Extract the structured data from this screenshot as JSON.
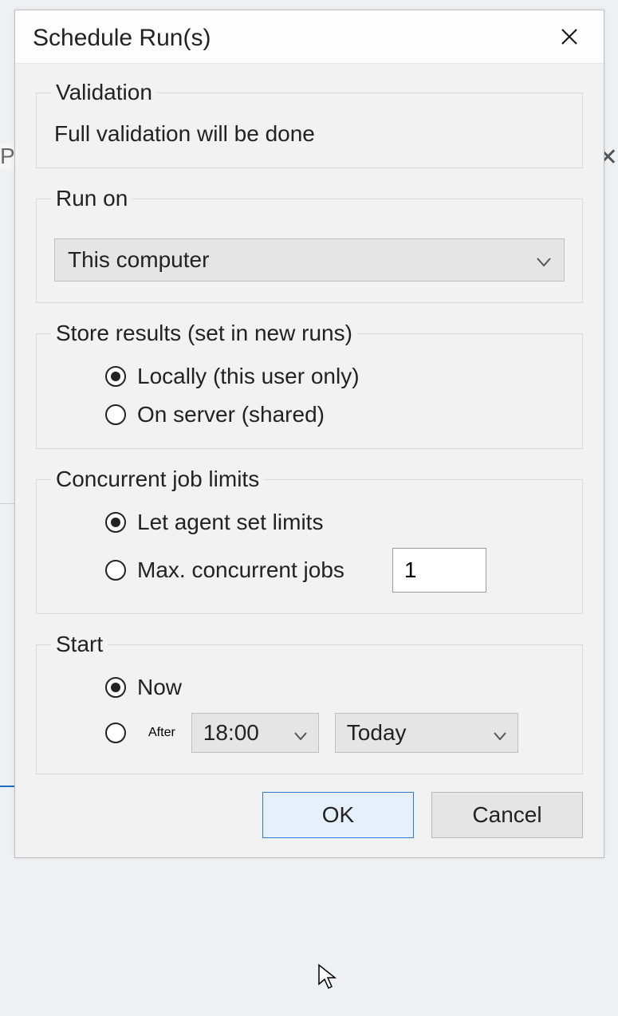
{
  "background": {
    "partial_tab_letter": "P"
  },
  "dialog": {
    "title": "Schedule Run(s)",
    "validation": {
      "legend": "Validation",
      "text": "Full validation will be done"
    },
    "run_on": {
      "legend": "Run on",
      "selected": "This computer"
    },
    "store_results": {
      "legend": "Store results (set in new runs)",
      "option_local": "Locally (this user only)",
      "option_server": "On server (shared)",
      "selected": "local"
    },
    "concurrent": {
      "legend": "Concurrent job limits",
      "option_agent": "Let agent set limits",
      "option_max": "Max. concurrent jobs",
      "max_value": "1",
      "selected": "agent"
    },
    "start": {
      "legend": "Start",
      "option_now": "Now",
      "option_after": "After",
      "time": "18:00",
      "day": "Today",
      "selected": "now"
    },
    "buttons": {
      "ok": "OK",
      "cancel": "Cancel"
    }
  }
}
